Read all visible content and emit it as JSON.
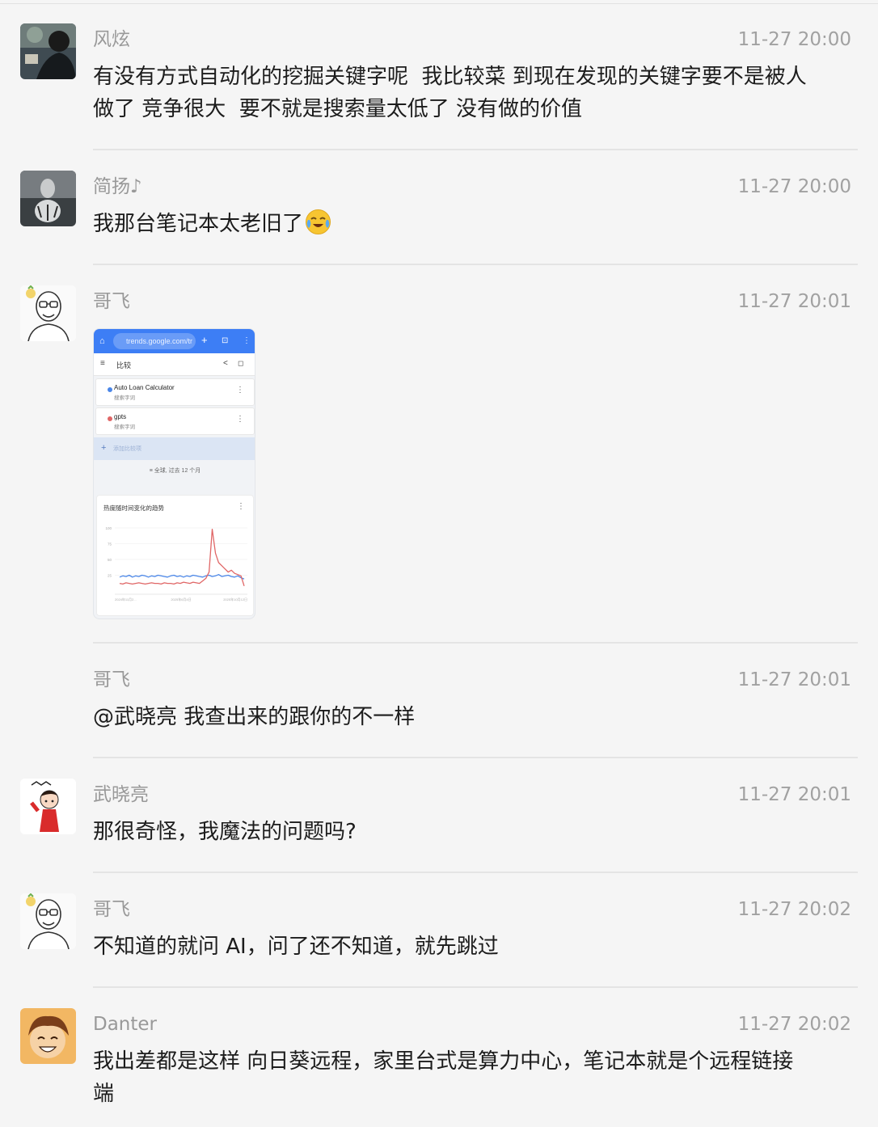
{
  "messages": [
    {
      "sender": "风炫",
      "time": "11-27 20:00",
      "lines": [
        "有没有方式自动化的挖掘关键字呢  我比较菜 到现在发现的关键字要不是被人",
        "做了 竞争很大  要不就是搜索量太低了 没有做的价值"
      ]
    },
    {
      "sender": "简扬♪",
      "time": "11-27 20:00",
      "lines": [
        "我那台笔记本太老旧了"
      ],
      "emoji": "face-with-tears-emoji"
    },
    {
      "sender": "哥飞",
      "time": "11-27 20:01",
      "image": true
    },
    {
      "sender": "哥飞",
      "time": "11-27 20:01",
      "lines": [
        "@武晓亮 我查出来的跟你的不一样"
      ]
    },
    {
      "sender": "武晓亮",
      "time": "11-27 20:01",
      "lines": [
        "那很奇怪，我魔法的问题吗?"
      ]
    },
    {
      "sender": "哥飞",
      "time": "11-27 20:02",
      "lines": [
        "不知道的就问 AI，问了还不知道，就先跳过"
      ]
    },
    {
      "sender": "Danter",
      "time": "11-27 20:02",
      "lines": [
        "我出差都是这样 向日葵远程，家里台式是算力中心，笔记本就是个远程链接",
        "端"
      ]
    }
  ],
  "trends_screenshot": {
    "url": "trends.google.com/tr",
    "toolbar_title": "比较",
    "terms": [
      {
        "name": "Auto Loan Calculator",
        "sub": "搜索字词",
        "color": "#4a86e8"
      },
      {
        "name": "gpts",
        "sub": "搜索字词",
        "color": "#e06666"
      }
    ],
    "add_label": "添加比较项",
    "filter": "全球, 过去 12 个月",
    "chart_title": "热度随时间变化的趋势",
    "chart_data": {
      "type": "line",
      "title": "热度随时间变化的趋势",
      "ylim": [
        0,
        100
      ],
      "yticks": [
        "100",
        "75",
        "50",
        "25"
      ],
      "xticks": [
        "2024年11月2...",
        "2025年6月4日",
        "2025年10月12日"
      ],
      "series": [
        {
          "color": "#4a86e8",
          "values": [
            22,
            24,
            23,
            25,
            22,
            24,
            23,
            25,
            24,
            22,
            24,
            23,
            25,
            24,
            23,
            22,
            24,
            25,
            23,
            24,
            22,
            24,
            23,
            25,
            24,
            23,
            22,
            24,
            25,
            23,
            24,
            26,
            23,
            24,
            25,
            23,
            22,
            24,
            21,
            19
          ]
        },
        {
          "color": "#e06666",
          "values": [
            12,
            11,
            13,
            12,
            11,
            12,
            13,
            12,
            11,
            12,
            13,
            12,
            12,
            11,
            13,
            12,
            12,
            11,
            13,
            12,
            14,
            13,
            12,
            14,
            13,
            12,
            16,
            20,
            30,
            98,
            60,
            45,
            40,
            35,
            30,
            33,
            28,
            26,
            24,
            8
          ]
        }
      ]
    }
  }
}
